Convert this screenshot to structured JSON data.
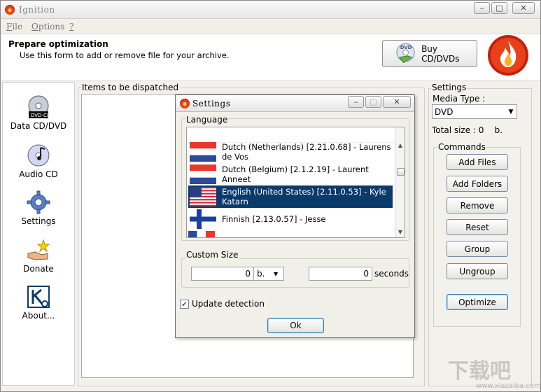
{
  "window": {
    "title": "Ignition",
    "controls": [
      "–",
      "□",
      "✕"
    ]
  },
  "menu": [
    {
      "first": "F",
      "rest": "ile"
    },
    {
      "first": "O",
      "rest": "ptions"
    },
    {
      "first": "?",
      "rest": ""
    }
  ],
  "header": {
    "title": "Prepare optimization",
    "subtitle": "Use this form to add or remove file for your archive.",
    "buy_button": "Buy CD/DVDs",
    "dvd_badge": "DVD"
  },
  "nav": [
    {
      "label": "Data CD/DVD",
      "icon": "dvd-icon",
      "disc_text": "DVD-CD"
    },
    {
      "label": "Audio CD",
      "icon": "audio-cd-icon"
    },
    {
      "label": "Settings",
      "icon": "gear-icon"
    },
    {
      "label": "Donate",
      "icon": "donate-icon"
    },
    {
      "label": "About...",
      "icon": "about-icon"
    }
  ],
  "items": {
    "label": "Items to be dispatched"
  },
  "settings_panel": {
    "group_label": "Settings",
    "media_type_label": "Media Type :",
    "media_type_value": "DVD",
    "total_size": "Total size : 0    b.",
    "commands_label": "Commands",
    "commands": [
      "Add Files",
      "Add Folders",
      "Remove",
      "Reset",
      "Group",
      "Ungroup"
    ],
    "optimize": "Optimize"
  },
  "dialog": {
    "title": "Settings",
    "language_label": "Language",
    "languages": [
      {
        "name": "Dutch (Netherlands) [2.21.0.68] - Laurens de Vos",
        "flag": "netherlands",
        "selected": false
      },
      {
        "name": "Dutch (Belgium) [2.1.2.19] - Laurent Anneet",
        "flag": "netherlands",
        "selected": false
      },
      {
        "name": "English (United States) [2.11.0.53] - Kyle Katarn",
        "flag": "usa",
        "selected": true
      },
      {
        "name": "Finnish [2.13.0.57] - Jesse",
        "flag": "finland",
        "selected": false
      }
    ],
    "custom_size_label": "Custom Size",
    "size_value": "0",
    "size_unit": "b.",
    "seconds_value": "0",
    "seconds_label": "seconds",
    "update_detection": "Update detection",
    "update_checked": true,
    "ok": "Ok"
  },
  "watermark": {
    "text": "下载吧",
    "url": "www.xiazaiba.com"
  },
  "colors": {
    "selection": "#0a3a6a",
    "flame": "#e8401a"
  }
}
